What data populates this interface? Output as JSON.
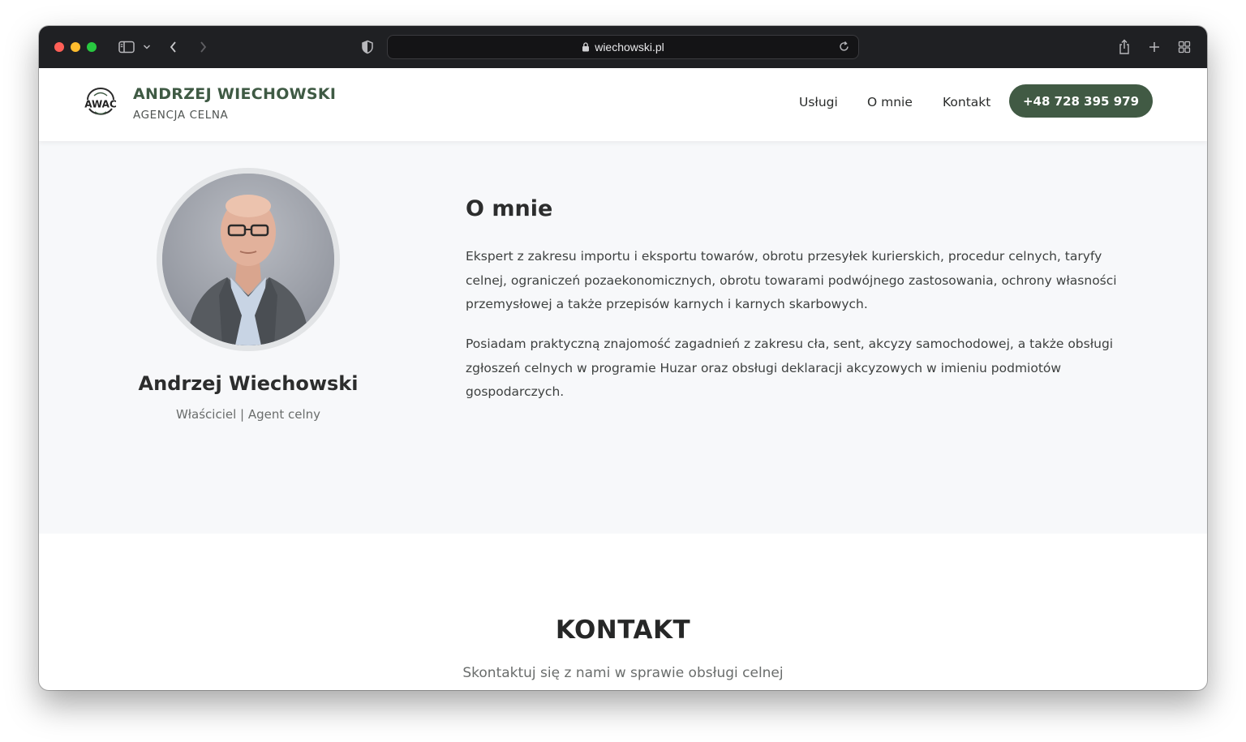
{
  "browser": {
    "url": "wiechowski.pl",
    "traffic_colors": [
      "#ff5f57",
      "#febc2e",
      "#28c840"
    ]
  },
  "header": {
    "brand_name": "ANDRZEJ WIECHOWSKI",
    "brand_sub": "AGENCJA CELNA",
    "logo_text": "AWAC",
    "nav": {
      "services": "Usługi",
      "about": "O mnie",
      "contact": "Kontakt"
    },
    "phone": "+48 728 395 979",
    "accent": "#415a44"
  },
  "about": {
    "name": "Andrzej Wiechowski",
    "role": "Właściciel | Agent celny",
    "title": "O mnie",
    "paragraphs": [
      "Ekspert z zakresu importu i eksportu towarów, obrotu przesyłek kurierskich, procedur celnych, taryfy celnej, ograniczeń pozaekonomicznych, obrotu towarami podwójnego zastosowania, ochrony własności przemysłowej a także przepisów karnych i karnych skarbowych.",
      "Posiadam praktyczną znajomość zagadnień z zakresu cła, sent, akcyzy samochodowej, a także obsługi zgłoszeń celnych w programie Huzar oraz obsługi deklaracji akcyzowych w imieniu podmiotów gospodarczych."
    ]
  },
  "contact": {
    "title": "KONTAKT",
    "subtitle": "Skontaktuj się z nami w sprawie obsługi celnej"
  }
}
